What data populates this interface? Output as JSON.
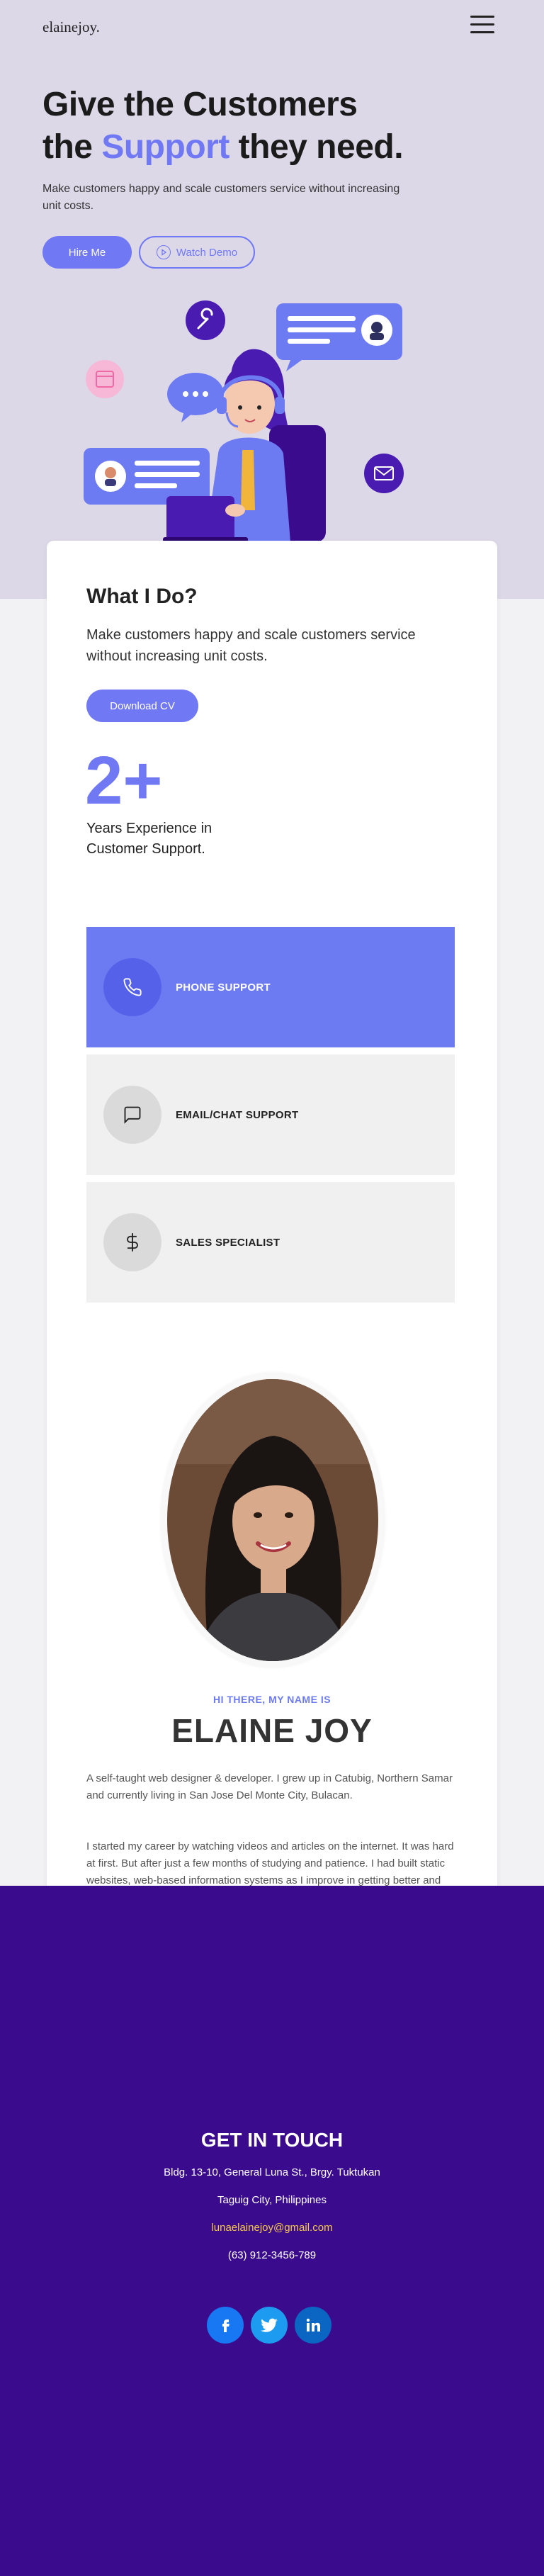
{
  "header": {
    "logo": "elainejoy.",
    "menu_icon": "hamburger-menu-icon"
  },
  "hero": {
    "headline_line1": "Give the Customers",
    "headline_the": "the ",
    "headline_accent": "Support",
    "headline_end": " they need.",
    "subtitle": "Make customers happy and scale customers service without increasing unit costs.",
    "hire_label": "Hire Me",
    "demo_label": "Watch Demo",
    "accent_color": "#7078f3"
  },
  "what": {
    "title": "What I Do?",
    "subtitle": "Make customers happy and scale customers service without increasing unit costs.",
    "cv_label": "Download CV",
    "years_number": "2+",
    "years_label": "Years Experience in Customer Support."
  },
  "services": [
    {
      "label": "PHONE SUPPORT",
      "icon": "phone-icon",
      "active": true
    },
    {
      "label": "EMAIL/CHAT SUPPORT",
      "icon": "chat-bubble-icon",
      "active": false
    },
    {
      "label": "SALES SPECIALIST",
      "icon": "dollar-icon",
      "active": false
    }
  ],
  "about": {
    "greeting": "HI THERE, MY NAME IS",
    "name": "ELAINE JOY",
    "bio1": "A self-taught web designer & developer. I grew up in Catubig, Northern Samar and currently living in San Jose Del Monte City, Bulacan.",
    "bio2": "I started my career by watching videos and articles on the internet. It was hard at first. But after just a few months of studying and patience. I had built static websites, web-based information systems as I improve in getting better and better. I'm also interested in people where I can excel, learn or absorb and give my best to become an expert or professional."
  },
  "contact": {
    "title": "GET IN TOUCH",
    "address1": "Bldg. 13-10, General Luna St., Brgy. Tuktukan",
    "address2": "Taguig City, Philippines",
    "email": "lunaelainejoy@gmail.com",
    "phone": "(63) 912-3456-789",
    "footer_color": "#3a0b8d"
  }
}
